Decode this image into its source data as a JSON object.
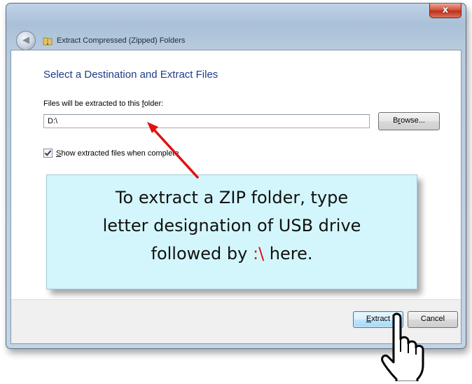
{
  "window": {
    "title": "Extract Compressed (Zipped) Folders",
    "close_label": "x"
  },
  "dialog": {
    "heading": "Select a Destination and Extract Files",
    "field_label_pre": "Files will be extracted to this ",
    "field_label_accel": "f",
    "field_label_post": "older:",
    "path_value": "D:\\",
    "browse_pre": "B",
    "browse_accel": "r",
    "browse_post": "owse...",
    "checkbox_accel": "S",
    "checkbox_post": "how extracted files when complete",
    "checkbox_checked": true,
    "extract_accel": "E",
    "extract_post": "xtract",
    "cancel_label": "Cancel"
  },
  "callout": {
    "line1": "To extract a ZIP folder, type",
    "line2": "letter designation of USB drive",
    "line3_pre": "followed by ",
    "line3_highlight": ":\\",
    "line3_post": " here.",
    "highlight_color": "#e01010"
  },
  "icons": {
    "back": "back-arrow-icon",
    "folder": "zip-folder-icon",
    "pointer": "hand-pointer-icon",
    "arrow": "red-arrow-annotation"
  }
}
